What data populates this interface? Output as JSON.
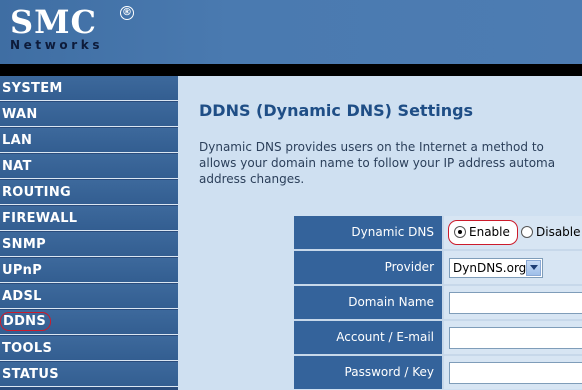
{
  "header": {
    "logo_main": "SMC",
    "logo_reg": "®",
    "logo_sub": "Networks",
    "bg_color": "#4a7ab0"
  },
  "sidebar": {
    "items": [
      {
        "label": "SYSTEM",
        "active": false
      },
      {
        "label": "WAN",
        "active": false
      },
      {
        "label": "LAN",
        "active": false
      },
      {
        "label": "NAT",
        "active": false
      },
      {
        "label": "ROUTING",
        "active": false
      },
      {
        "label": "FIREWALL",
        "active": false
      },
      {
        "label": "SNMP",
        "active": false
      },
      {
        "label": "UPnP",
        "active": false
      },
      {
        "label": "ADSL",
        "active": false
      },
      {
        "label": "DDNS",
        "active": true
      },
      {
        "label": "TOOLS",
        "active": false
      },
      {
        "label": "STATUS",
        "active": false
      }
    ],
    "highlight_color": "#cc1b2b"
  },
  "main": {
    "title": "DDNS (Dynamic DNS) Settings",
    "description": [
      "Dynamic DNS provides users on the Internet a method to",
      "allows your domain name to follow your IP address automa",
      "address changes."
    ],
    "form": {
      "dynamic_dns": {
        "label": "Dynamic DNS",
        "enable_label": "Enable",
        "disable_label": "Disable",
        "selected": "Enable"
      },
      "provider": {
        "label": "Provider",
        "value": "DynDNS.org"
      },
      "domain_name": {
        "label": "Domain Name",
        "value": ""
      },
      "account": {
        "label": "Account / E-mail",
        "value": ""
      },
      "password": {
        "label": "Password / Key",
        "value": ""
      }
    }
  }
}
